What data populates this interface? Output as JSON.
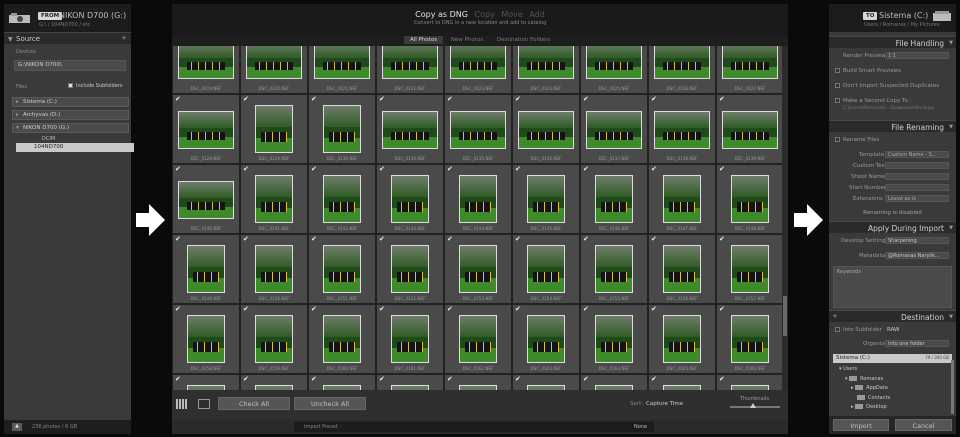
{
  "source": {
    "from_tag": "FROM",
    "device_name": "NIKON D700 (G:)",
    "device_path": "G:\\ / 104ND700 / etc",
    "panel_title": "Source",
    "devices_label": "Devices",
    "device_field": "G:\\NIKON D700\\",
    "files_label": "Files",
    "include_subfolders": "Include Subfolders",
    "volumes": [
      "Sistema (C:)",
      "Archyvas (D:)",
      "NIKON D700 (G:)"
    ],
    "dcim": "DCIM",
    "selected_folder": "104ND700",
    "footer_count": "236 photos / 6 GB"
  },
  "center": {
    "modes": [
      "Copy as DNG",
      "Copy",
      "Move",
      "Add"
    ],
    "mode_subtitle": "Convert to DNG in a new location and add to catalog",
    "filters": [
      "All Photos",
      "New Photos",
      "Destination Folders"
    ],
    "photos": [
      "DSC_4119.NEF",
      "DSC_4120.NEF",
      "DSC_4121.NEF",
      "DSC_4122.NEF",
      "DSC_4123.NEF",
      "DSC_4124.NEF",
      "DSC_4125.NEF",
      "DSC_4126.NEF",
      "DSC_4127.NEF",
      "DSC_4128.NEF",
      "DSC_4129.NEF",
      "DSC_4130.NEF",
      "DSC_4134.NEF",
      "DSC_4135.NEF",
      "DSC_4136.NEF",
      "DSC_4137.NEF",
      "DSC_4138.NEF",
      "DSC_4139.NEF",
      "DSC_4140.NEF",
      "DSC_4141.NEF",
      "DSC_4142.NEF",
      "DSC_4143.NEF",
      "DSC_4144.NEF",
      "DSC_4145.NEF",
      "DSC_4146.NEF",
      "DSC_4147.NEF",
      "DSC_4148.NEF",
      "DSC_4149.NEF",
      "DSC_4150.NEF",
      "DSC_4151.NEF",
      "DSC_4152.NEF",
      "DSC_4153.NEF",
      "DSC_4154.NEF",
      "DSC_4155.NEF",
      "DSC_4156.NEF",
      "DSC_4157.NEF",
      "DSC_4158.NEF",
      "DSC_4159.NEF",
      "DSC_4160.NEF",
      "DSC_4161.NEF",
      "DSC_4162.NEF",
      "DSC_4163.NEF",
      "DSC_4164.NEF",
      "DSC_4165.NEF",
      "DSC_4166.NEF",
      "",
      "",
      "",
      "",
      "",
      "",
      "",
      "",
      ""
    ],
    "check_all": "Check All",
    "uncheck_all": "Uncheck All",
    "sort_label": "Sort:",
    "sort_value": "Capture Time",
    "thumbnails_label": "Thumbnails",
    "import_preset_label": "Import Preset :",
    "import_preset_value": "None"
  },
  "destination": {
    "to_tag": "TO",
    "device_name": "Sistema (C:)",
    "device_path": "Users / Romanas / My Pictures",
    "file_handling": {
      "title": "File Handling",
      "render_previews_label": "Render Previews",
      "render_previews_value": "1:1",
      "build_smart": "Build Smart Previews",
      "dont_import_dupes": "Don't Import Suspected Duplicates",
      "second_copy": "Make a Second Copy To :",
      "second_copy_path": "C:\\Users\\Romanas\\...\\Download Backups"
    },
    "file_renaming": {
      "title": "File Renaming",
      "rename_files": "Rename Files",
      "template_label": "Template",
      "template_value": "Custom Name - S...",
      "custom_text_label": "Custom Text",
      "shoot_name_label": "Shoot Name",
      "start_number_label": "Start Number",
      "extensions_label": "Extensions",
      "extensions_value": "Leave as-is",
      "disabled_note": "Renaming is disabled"
    },
    "apply_during_import": {
      "title": "Apply During Import",
      "develop_label": "Develop Settings",
      "develop_value": "Sharpening",
      "metadata_label": "Metadata",
      "metadata_value": "@Romanas Naryšk...",
      "keywords_label": "Keywords"
    },
    "dest_panel": {
      "title": "Destination",
      "into_subfolder": "Into Subfolder",
      "subfolder_value": "RAW",
      "organize_label": "Organize",
      "organize_value": "Into one folder",
      "drive": "Sistema (C:)",
      "drive_size": "79 / 300 GB",
      "tree": [
        "Users",
        "Romanas",
        "AppData",
        "Contacts",
        "Desktop"
      ]
    },
    "import_button": "Import",
    "cancel_button": "Cancel"
  },
  "colors": {
    "panel": "#3a3a3a",
    "dark": "#1c1c1c",
    "grid_bg": "#3c3c3c",
    "grass": "#3f8a2a"
  }
}
